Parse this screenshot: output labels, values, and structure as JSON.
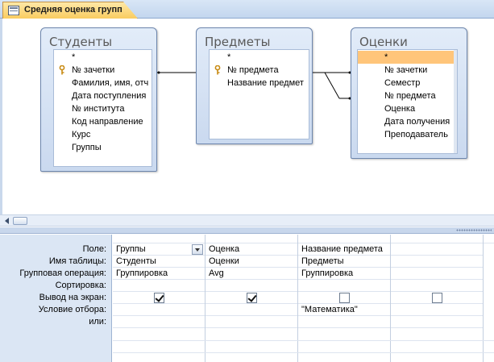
{
  "tab": {
    "title": "Средняя оценка групп"
  },
  "tables": {
    "students": {
      "title": "Студенты",
      "fields": [
        "*",
        "№ зачетки",
        "Фамилия, имя, отч",
        "Дата поступления",
        "№ института",
        "Код направление",
        "Курс",
        "Группы"
      ]
    },
    "subjects": {
      "title": "Предметы",
      "fields": [
        "*",
        "№ предмета",
        "Название предмет"
      ]
    },
    "grades": {
      "title": "Оценки",
      "fields": [
        "*",
        "№ зачетки",
        "Семестр",
        "№ предмета",
        "Оценка",
        "Дата получения",
        "Преподаватель"
      ]
    }
  },
  "grid": {
    "row_labels": [
      "Поле:",
      "Имя таблицы:",
      "Групповая операция:",
      "Сортировка:",
      "Вывод на экран:",
      "Условие отбора:",
      "или:"
    ],
    "columns": [
      {
        "field": "Группы",
        "table": "Студенты",
        "operation": "Группировка",
        "sort": "",
        "show": true,
        "criteria": "",
        "or": ""
      },
      {
        "field": "Оценка",
        "table": "Оценки",
        "operation": "Avg",
        "sort": "",
        "show": true,
        "criteria": "",
        "or": ""
      },
      {
        "field": "Название предмета",
        "table": "Предметы",
        "operation": "Группировка",
        "sort": "",
        "show": false,
        "criteria": "\"Математика\"",
        "or": ""
      },
      {
        "field": "",
        "table": "",
        "operation": "",
        "sort": "",
        "show": false,
        "criteria": "",
        "or": ""
      }
    ]
  },
  "colors": {
    "accent": "#ffc57a",
    "pane": "#dbe6f4",
    "border": "#6d86ad"
  }
}
